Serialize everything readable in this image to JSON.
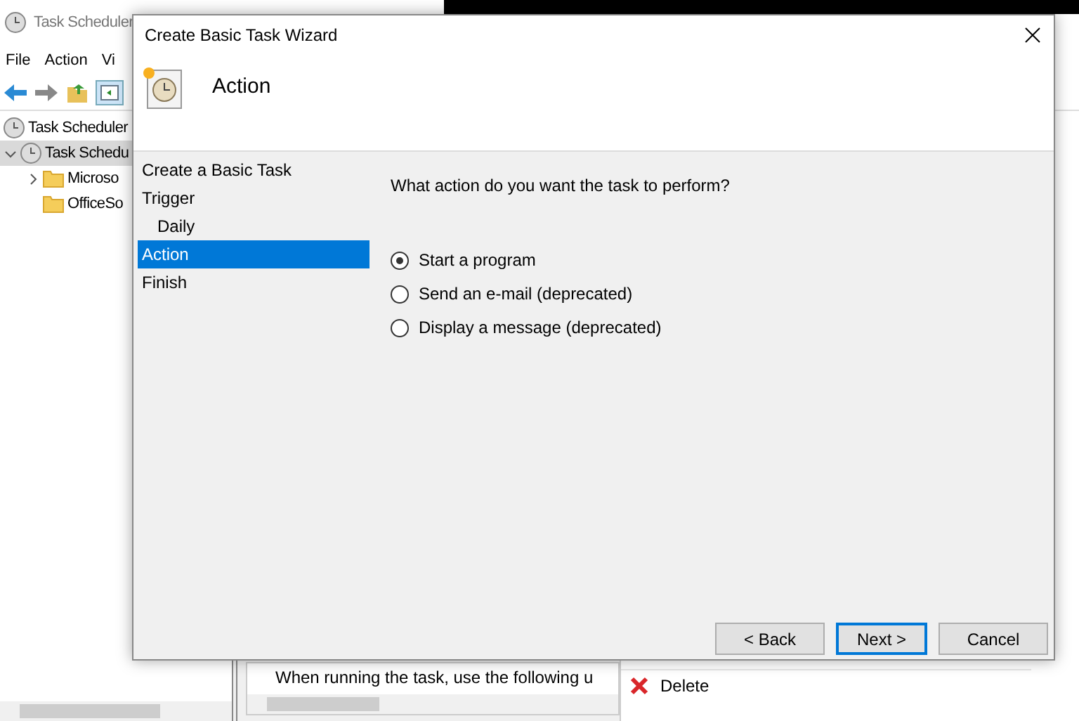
{
  "main_window": {
    "title": "Task Scheduler",
    "menu": [
      "File",
      "Action",
      "Vi"
    ],
    "tree": [
      {
        "label": "Task Scheduler",
        "selected": false,
        "children": [
          {
            "label": "Task Schedu",
            "selected": true,
            "expanded": true,
            "children": [
              {
                "label": "Microso",
                "selected": false,
                "expanded": false
              },
              {
                "label": "OfficeSo",
                "selected": false
              }
            ]
          }
        ]
      }
    ],
    "general_text": "When running the task, use the following u",
    "actions": [
      {
        "label": "Delete"
      }
    ]
  },
  "dialog": {
    "title": "Create Basic Task Wizard",
    "heading": "Action",
    "steps": [
      {
        "label": "Create a Basic Task",
        "selected": false
      },
      {
        "label": "Trigger",
        "selected": false,
        "children": [
          {
            "label": "Daily",
            "selected": false
          }
        ]
      },
      {
        "label": "Action",
        "selected": true
      },
      {
        "label": "Finish",
        "selected": false
      }
    ],
    "question": "What action do you want the task to perform?",
    "options": [
      {
        "label": "Start a program",
        "selected": true
      },
      {
        "label": "Send an e-mail (deprecated)",
        "selected": false
      },
      {
        "label": "Display a message (deprecated)",
        "selected": false
      }
    ],
    "buttons": [
      {
        "label": "< Back",
        "default": false
      },
      {
        "label": "Next >",
        "default": true
      },
      {
        "label": "Cancel",
        "default": false
      }
    ]
  }
}
